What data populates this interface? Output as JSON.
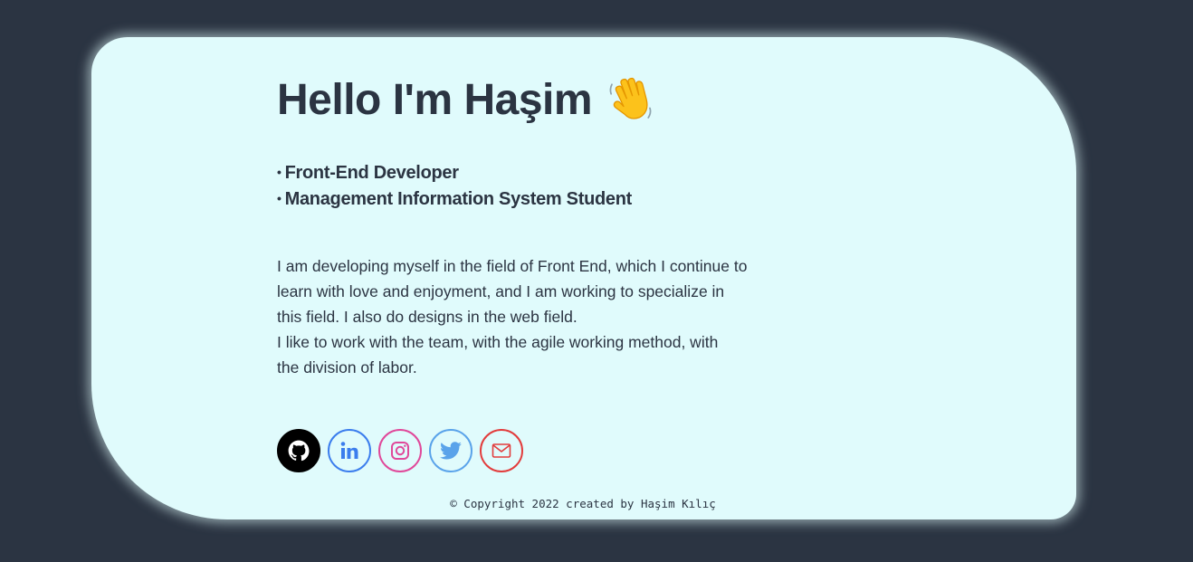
{
  "hero": {
    "title": "Hello I'm Haşim",
    "wave_icon": "waving-hand-icon"
  },
  "roles": [
    {
      "bullet": "•",
      "label": "Front-End Developer"
    },
    {
      "bullet": "•",
      "label": "Management Information System Student"
    }
  ],
  "bio": {
    "lines": [
      "I am developing myself in the field of Front End, which I continue to",
      "learn with love and enjoyment, and I am working to specialize in",
      "this field. I also do designs in the web field.",
      "I like to work with the team, with the agile working method, with",
      "the division of labor."
    ]
  },
  "socials": [
    {
      "name": "github",
      "icon": "github-icon",
      "color": "#000000"
    },
    {
      "name": "linkedin",
      "icon": "linkedin-icon",
      "color": "#3b7ded"
    },
    {
      "name": "instagram",
      "icon": "instagram-icon",
      "color": "#e0489a"
    },
    {
      "name": "twitter",
      "icon": "twitter-icon",
      "color": "#5aa3ea"
    },
    {
      "name": "mail",
      "icon": "mail-icon",
      "color": "#e23c3c"
    }
  ],
  "footer": {
    "text": "© Copyright 2022 created by Haşim Kılıç"
  },
  "colors": {
    "page_background": "#2b3442",
    "card_background": "#e0fbfc",
    "text": "#2b3442"
  }
}
